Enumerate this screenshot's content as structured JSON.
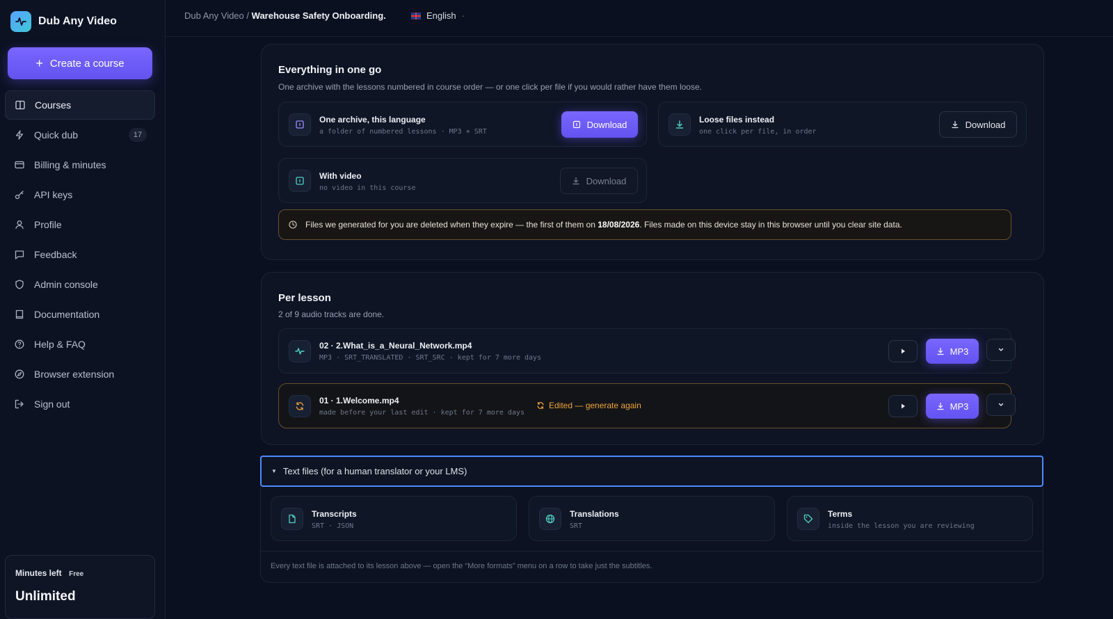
{
  "app": {
    "name": "Dub Any Video"
  },
  "sidebar": {
    "create_label": "Create a course",
    "items": [
      {
        "label": "Courses",
        "icon": "book-open-icon"
      },
      {
        "label": "Quick dub",
        "icon": "bolt-icon",
        "badge": "17"
      },
      {
        "label": "Billing & minutes",
        "icon": "credit-card-icon"
      },
      {
        "label": "API keys",
        "icon": "key-icon"
      },
      {
        "label": "Profile",
        "icon": "user-icon"
      },
      {
        "label": "Feedback",
        "icon": "message-icon"
      },
      {
        "label": "Admin console",
        "icon": "shield-icon"
      },
      {
        "label": "Documentation",
        "icon": "book-icon"
      },
      {
        "label": "Help & FAQ",
        "icon": "help-circle-icon"
      },
      {
        "label": "Browser extension",
        "icon": "compass-icon"
      },
      {
        "label": "Sign out",
        "icon": "logout-icon"
      }
    ],
    "minutes": {
      "label": "Minutes left",
      "tag": "Free",
      "value": "Unlimited"
    }
  },
  "header": {
    "breadcrumb_root": "Dub Any Video",
    "separator": "/",
    "breadcrumb_current": "Warehouse Safety Onboarding.",
    "language": "English",
    "language_suffix": "·"
  },
  "all_in_one": {
    "title": "Everything in one go",
    "subtitle": "One archive with the lessons numbered in course order — or one click per file if you would rather have them loose.",
    "archive": {
      "title": "One archive, this language",
      "sub": "a folder of numbered lessons · MP3 + SRT",
      "button": "Download"
    },
    "loose": {
      "title": "Loose files instead",
      "sub": "one click per file, in order",
      "button": "Download"
    },
    "video": {
      "title": "With video",
      "sub": "no video in this course",
      "button": "Download"
    },
    "notice": {
      "before": "Files we generated for you are deleted when they expire — the first of them on",
      "date": "18/08/2026",
      "after": ". Files made on this device stay in this browser until you clear site data."
    }
  },
  "per_lesson": {
    "title": "Per lesson",
    "subtitle": "2 of 9 audio tracks are done.",
    "rows": [
      {
        "title": "02 · 2.What_is_a_Neural_Network.mp4",
        "sub": "MP3 · SRT_TRANSLATED · SRT_SRC · kept for 7 more days",
        "button": "MP3"
      },
      {
        "title": "01 · 1.Welcome.mp4",
        "sub": "made before your last edit · kept for 7 more days",
        "status": "Edited — generate again",
        "button": "MP3"
      }
    ]
  },
  "text_files": {
    "summary": "Text files (for a human translator or your LMS)",
    "tiles": [
      {
        "title": "Transcripts",
        "sub": "SRT · JSON",
        "icon": "file-icon"
      },
      {
        "title": "Translations",
        "sub": "SRT",
        "icon": "globe-icon"
      },
      {
        "title": "Terms",
        "sub": "inside the lesson you are reviewing",
        "icon": "tag-icon"
      }
    ],
    "footnote": "Every text file is attached to its lesson above — open the “More formats” menu on a row to take just the subtitles."
  },
  "colors": {
    "accent": "#6d5cff",
    "warning": "#f0a53a",
    "teal": "#4fd1c5",
    "focus": "#4a8cff"
  }
}
